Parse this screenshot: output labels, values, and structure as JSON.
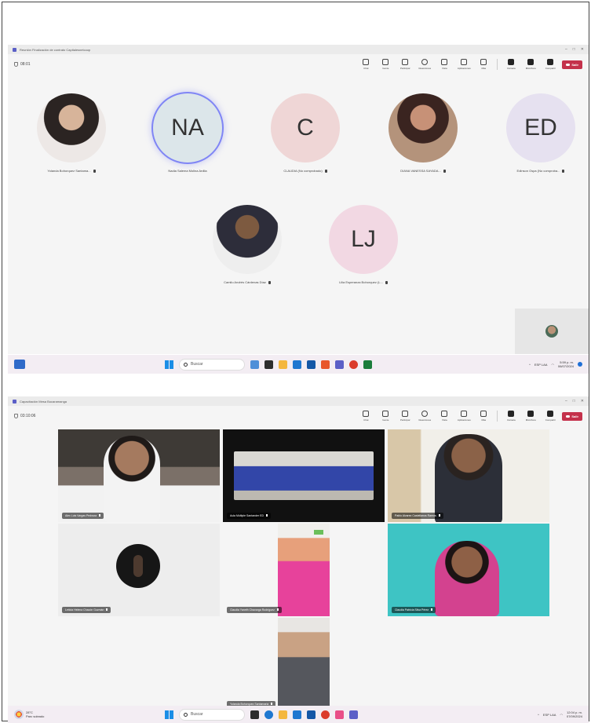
{
  "window1": {
    "title": "Reunión Finalización de contrato Capitalesnetcoop",
    "timer": "08:01",
    "toolbar": [
      "Chat",
      "Gente",
      "Participar",
      "Reacciones",
      "Vista",
      "Aplicaciones",
      "Más",
      "Cámara",
      "Micrófono",
      "Compartir"
    ],
    "leave_label": "Salir",
    "participants": [
      {
        "name": "Yolanda Bohorquez Santama...",
        "initials": "",
        "color": "#ffffff"
      },
      {
        "name": "Nadia Salema Molina Ardila",
        "initials": "NA",
        "color": "#dce6ea"
      },
      {
        "name": "CLAUDIA (No comprobado)",
        "initials": "C",
        "color": "#efd6d6"
      },
      {
        "name": "DIANA VANESSA SAYADA...",
        "initials": "",
        "color": "#ffffff"
      },
      {
        "name": "Edinson Ospa (No comproba...",
        "initials": "ED",
        "color": "#e6e1f0"
      },
      {
        "name": "Camilo Andrés Cárdenas Díaz",
        "initials": "",
        "color": "#ffffff"
      },
      {
        "name": "Lilia Esperanza Bohorquez (L...",
        "initials": "LJ",
        "color": "#f2d8e3"
      }
    ]
  },
  "taskbar1": {
    "search_placeholder": "Buscar",
    "lang": "ESP LAA",
    "time": "5:59 p. m.",
    "date": "06/07/2024"
  },
  "window2": {
    "title": "Capacitación Mesa Bucaramanga",
    "timer": "03:10:06",
    "toolbar": [
      "Chat",
      "Gente",
      "Participar",
      "Reacciones",
      "Vista",
      "Aplicaciones",
      "Más",
      "Cámara",
      "Micrófono",
      "Compartir"
    ],
    "leave_label": "Salir",
    "tiles": [
      {
        "name": "Alex Luis Vargas Pedraza",
        "style": "v-room"
      },
      {
        "name": "Aula Múltiple Santander ED",
        "style": "v-hall"
      },
      {
        "name": "Pablo Alvarez Castellanos Ramos",
        "style": "v-office"
      },
      {
        "name": "Leticia Helena Chacón Guzmán",
        "style": "v-plain"
      },
      {
        "name": "Claudia Yaneth Chavarga Rodríguez",
        "style": "v-portrait"
      },
      {
        "name": "Claudia Patricia Silva Pérez",
        "style": "v-teal"
      },
      {
        "name": "Yolanda Bohorquez Santamaria",
        "style": "v-portrait v-portrait2"
      }
    ]
  },
  "taskbar2": {
    "weather_temp": "28°C",
    "weather_desc": "Parc soleado",
    "search_placeholder": "Buscar",
    "lang": "ESP LAA",
    "time": "12:04 p. m.",
    "date": "07/09/2024"
  },
  "colors": {
    "accent": "#5b5fc7",
    "leave": "#c4314b",
    "stage": "#f5f5f5"
  }
}
